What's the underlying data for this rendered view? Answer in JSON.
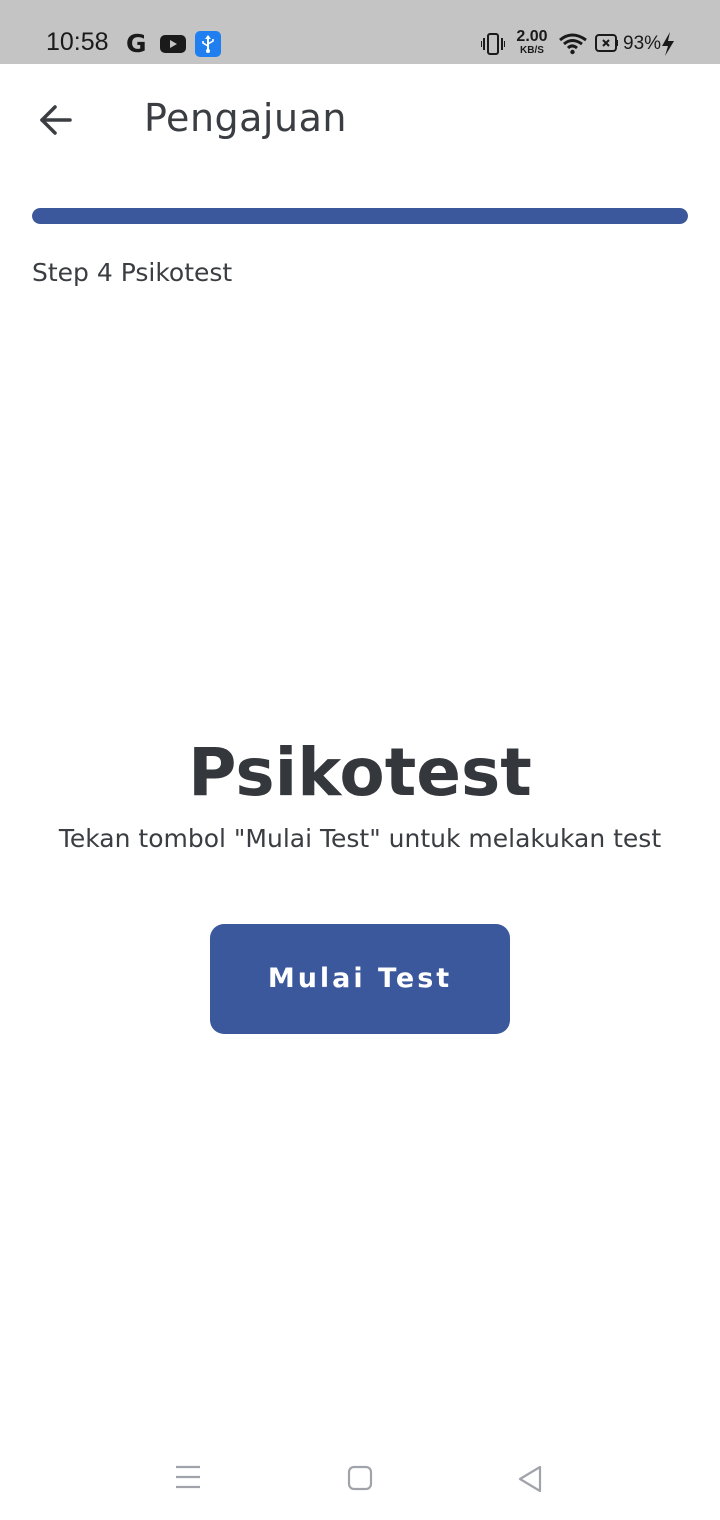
{
  "status_bar": {
    "time": "10:58",
    "net_speed_value": "2.00",
    "net_speed_unit": "KB/S",
    "battery_percent": "93%",
    "icons": [
      "google-icon",
      "youtube-icon",
      "usb-icon",
      "vibrate-icon",
      "wifi-icon",
      "battery-icon",
      "charging-icon"
    ]
  },
  "app_bar": {
    "title": "Pengajuan",
    "back_icon": "arrow-left-icon"
  },
  "progress": {
    "value": 1.0,
    "step_label": "Step 4 Psikotest",
    "color": "#3b589c"
  },
  "main": {
    "heading": "Psikotest",
    "description": "Tekan tombol \"Mulai Test\" untuk melakukan test",
    "button_label": "Mulai Test",
    "button_color": "#3b589c"
  },
  "nav_bar": {
    "icons": [
      "menu-icon",
      "home-icon",
      "back-triangle-icon"
    ]
  }
}
